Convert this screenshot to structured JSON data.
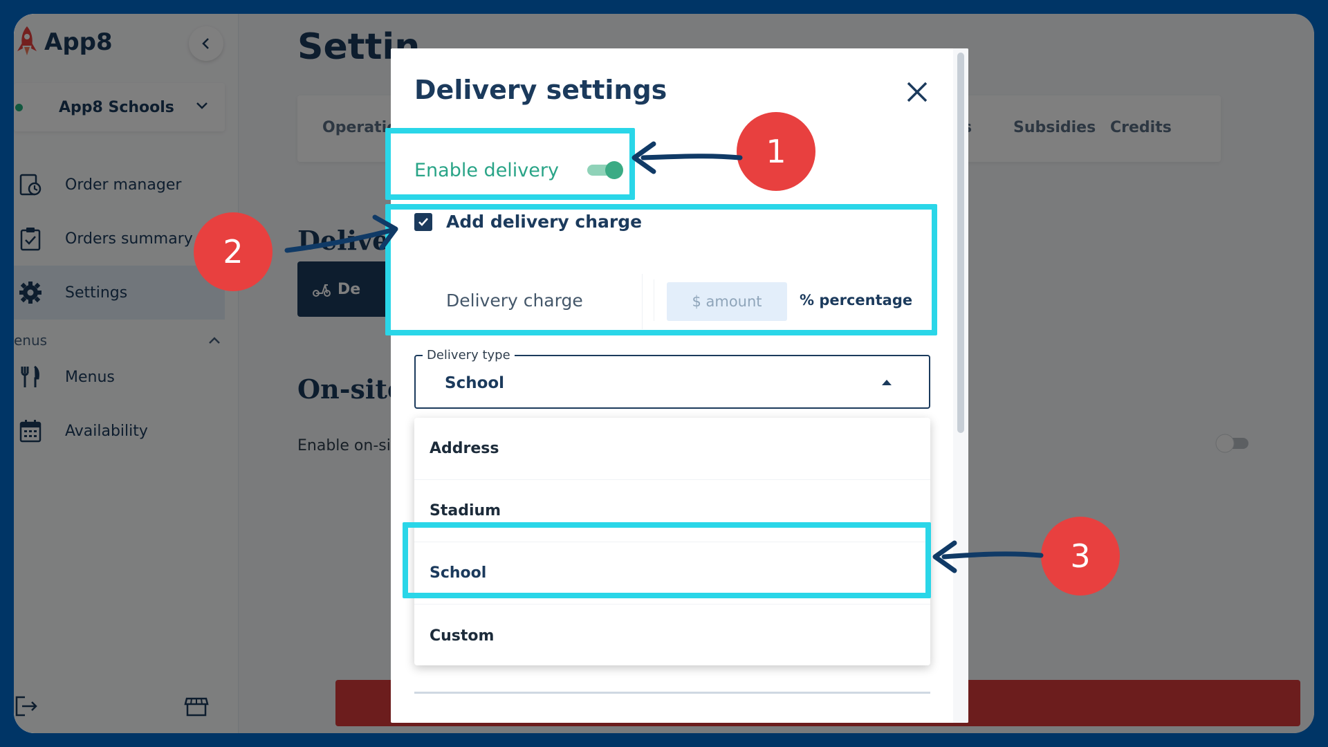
{
  "app": {
    "name": "App8",
    "org_name": "App8 Schools"
  },
  "sidebar": {
    "items": [
      {
        "label": "Order manager",
        "icon": "order-manager-icon"
      },
      {
        "label": "Orders summary",
        "icon": "clipboard-check-icon"
      },
      {
        "label": "Settings",
        "icon": "gear-icon",
        "active": true
      },
      {
        "label": "Menus",
        "icon": "utensils-icon"
      },
      {
        "label": "Availability",
        "icon": "calendar-icon"
      }
    ],
    "section_label": "enus"
  },
  "page": {
    "title": "Settin",
    "tabs": [
      "Operatic",
      "s",
      "Subsidies",
      "Credits"
    ],
    "section_delivery": "Deliver",
    "delivery_button": "De",
    "section_onsite": "On-site",
    "onsite_label": "Enable on-si"
  },
  "modal": {
    "title": "Delivery settings",
    "enable_delivery_label": "Enable delivery",
    "enable_delivery_on": true,
    "add_charge_label": "Add delivery charge",
    "add_charge_checked": true,
    "charge_field_label": "Delivery charge",
    "unit_amount": "$ amount",
    "unit_percent": "% percentage",
    "delivery_type_legend": "Delivery type",
    "delivery_type_value": "School",
    "options": [
      "Address",
      "Stadium",
      "School",
      "Custom"
    ],
    "selected_option": "School"
  },
  "annotations": {
    "badges": [
      "1",
      "2",
      "3"
    ],
    "highlight_color": "#2ad6e8",
    "badge_color": "#e8403f"
  },
  "colors": {
    "frame": "#003566",
    "primary": "#1b3a5c",
    "accent_green": "#29a487",
    "danger": "#d93a3a"
  }
}
